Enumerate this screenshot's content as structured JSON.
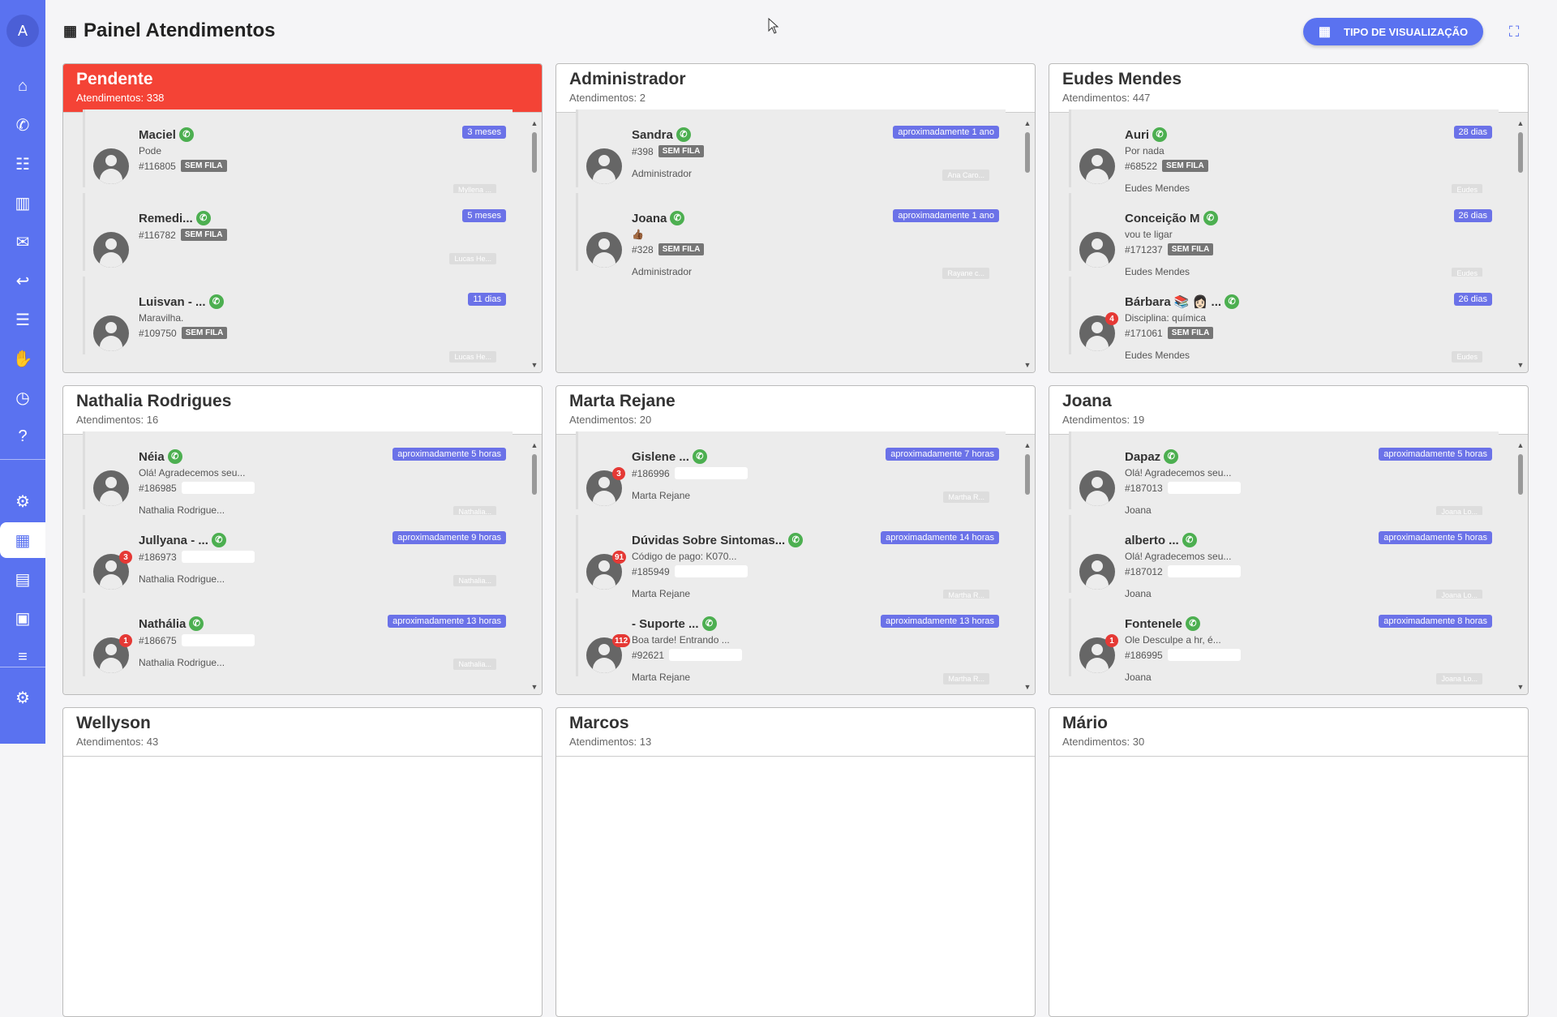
{
  "sidebar": {
    "avatar_letter": "A",
    "items": [
      {
        "icon": "home-icon",
        "glyph": "⌂"
      },
      {
        "icon": "whatsapp-icon",
        "glyph": "✆"
      },
      {
        "icon": "contacts-icon",
        "glyph": "☷"
      },
      {
        "icon": "kanban-icon",
        "glyph": "▥"
      },
      {
        "icon": "chat-icon",
        "glyph": "✉"
      },
      {
        "icon": "quick-reply-icon",
        "glyph": "↩"
      },
      {
        "icon": "clipboard-icon",
        "glyph": "☰"
      },
      {
        "icon": "handshake-icon",
        "glyph": "✋"
      },
      {
        "icon": "clock-icon",
        "glyph": "◷"
      },
      {
        "icon": "help-icon",
        "glyph": "?"
      },
      {
        "icon": "settings-icon",
        "glyph": "⚙"
      },
      {
        "icon": "dashboard-icon",
        "glyph": "▦"
      },
      {
        "icon": "report-icon",
        "glyph": "▤"
      },
      {
        "icon": "money-icon",
        "glyph": "▣"
      },
      {
        "icon": "list-icon",
        "glyph": "≡"
      },
      {
        "icon": "admin-settings-icon",
        "glyph": "⚙"
      }
    ]
  },
  "header": {
    "title": "Painel Atendimentos",
    "view_button": "TIPO DE VISUALIZAÇÃO"
  },
  "panels": [
    {
      "title": "Pendente",
      "count": "Atendimentos: 338",
      "tickets": [
        {
          "name": "Maciel",
          "msg": "Pode",
          "id": "#116805",
          "tag": "SEM FILA",
          "user": "",
          "time": "3 meses",
          "chip": "Myllena ..."
        },
        {
          "name": "Remedi...",
          "msg": "",
          "id": "#116782",
          "tag": "SEM FILA",
          "user": "",
          "time": "5 meses",
          "chip": "Lucas He..."
        },
        {
          "name": "Luisvan - ...",
          "msg": "Maravilha.",
          "id": "#109750",
          "tag": "SEM FILA",
          "user": "",
          "time": "11 dias",
          "chip": "Lucas He..."
        }
      ]
    },
    {
      "title": "Administrador",
      "count": "Atendimentos: 2",
      "tickets": [
        {
          "name": "Sandra",
          "msg": "",
          "id": "#398",
          "tag": "SEM FILA",
          "user": "Administrador",
          "time": "aproximadamente 1 ano",
          "chip": "Ana Caro..."
        },
        {
          "name": "Joana",
          "msg": "👍🏾",
          "id": "#328",
          "tag": "SEM FILA",
          "user": "Administrador",
          "time": "aproximadamente 1 ano",
          "chip": "Rayane c..."
        }
      ]
    },
    {
      "title": "Eudes Mendes",
      "count": "Atendimentos: 447",
      "tickets": [
        {
          "name": "Auri",
          "msg": "Por nada",
          "id": "#68522",
          "tag": "SEM FILA",
          "user": "Eudes Mendes",
          "time": "28 dias",
          "chip": "Eudes"
        },
        {
          "name": "Conceição M",
          "msg": "vou te ligar",
          "id": "#171237",
          "tag": "SEM FILA",
          "user": "Eudes Mendes",
          "time": "26 dias",
          "chip": "Eudes"
        },
        {
          "name": "Bárbara 📚 👩🏻 ...",
          "msg": "Disciplina: química",
          "id": "#171061",
          "tag": "SEM FILA",
          "user": "Eudes Mendes",
          "time": "26 dias",
          "chip": "Eudes",
          "badge": "4"
        }
      ]
    },
    {
      "title": "Nathalia Rodrigues",
      "count": "Atendimentos: 16",
      "tickets": [
        {
          "name": "Néia",
          "msg": "Olá! Agradecemos seu...",
          "id": "#186985",
          "tag": "",
          "user": "Nathalia Rodrigue...",
          "time": "aproximadamente 5 horas",
          "chip": "Nathalia..."
        },
        {
          "name": "Jullyana - ...",
          "msg": "",
          "id": "#186973",
          "tag": "",
          "user": "Nathalia Rodrigue...",
          "time": "aproximadamente 9 horas",
          "chip": "Nathalia...",
          "badge": "3"
        },
        {
          "name": "Nathália",
          "msg": "",
          "id": "#186675",
          "tag": "",
          "user": "Nathalia Rodrigue...",
          "time": "aproximadamente 13 horas",
          "chip": "Nathalia...",
          "badge": "1"
        }
      ]
    },
    {
      "title": "Marta Rejane",
      "count": "Atendimentos: 20",
      "tickets": [
        {
          "name": "Gislene ...",
          "msg": "",
          "id": "#186996",
          "tag": "",
          "user": "Marta Rejane",
          "time": "aproximadamente 7 horas",
          "chip": "Martha R...",
          "badge": "3"
        },
        {
          "name": "Dúvidas Sobre Sintomas...",
          "msg": "Código de pago: K070...",
          "id": "#185949",
          "tag": "",
          "user": "Marta Rejane",
          "time": "aproximadamente 14 horas",
          "chip": "Martha R...",
          "badge": "91"
        },
        {
          "name": "- Suporte ...",
          "msg": "Boa tarde! Entrando ...",
          "id": "#92621",
          "tag": "",
          "user": "Marta Rejane",
          "time": "aproximadamente 13 horas",
          "chip": "Martha R...",
          "badge": "112"
        }
      ]
    },
    {
      "title": "Joana",
      "count": "Atendimentos: 19",
      "tickets": [
        {
          "name": "Dapaz",
          "msg": "Olá! Agradecemos seu...",
          "id": "#187013",
          "tag": "",
          "user": "Joana",
          "time": "aproximadamente 5 horas",
          "chip": "Joana Lo..."
        },
        {
          "name": "alberto ...",
          "msg": "Olá! Agradecemos seu...",
          "id": "#187012",
          "tag": "",
          "user": "Joana",
          "time": "aproximadamente 5 horas",
          "chip": "Joana Lo..."
        },
        {
          "name": "Fontenele",
          "msg": "Ole Desculpe a hr, é...",
          "id": "#186995",
          "tag": "",
          "user": "Joana",
          "time": "aproximadamente 8 horas",
          "chip": "Joana Lo...",
          "badge": "1"
        }
      ]
    },
    {
      "title": "Wellyson",
      "count": "Atendimentos: 43",
      "tickets": []
    },
    {
      "title": "Marcos",
      "count": "Atendimentos: 13",
      "tickets": []
    },
    {
      "title": "Mário",
      "count": "Atendimentos: 30",
      "tickets": []
    }
  ]
}
